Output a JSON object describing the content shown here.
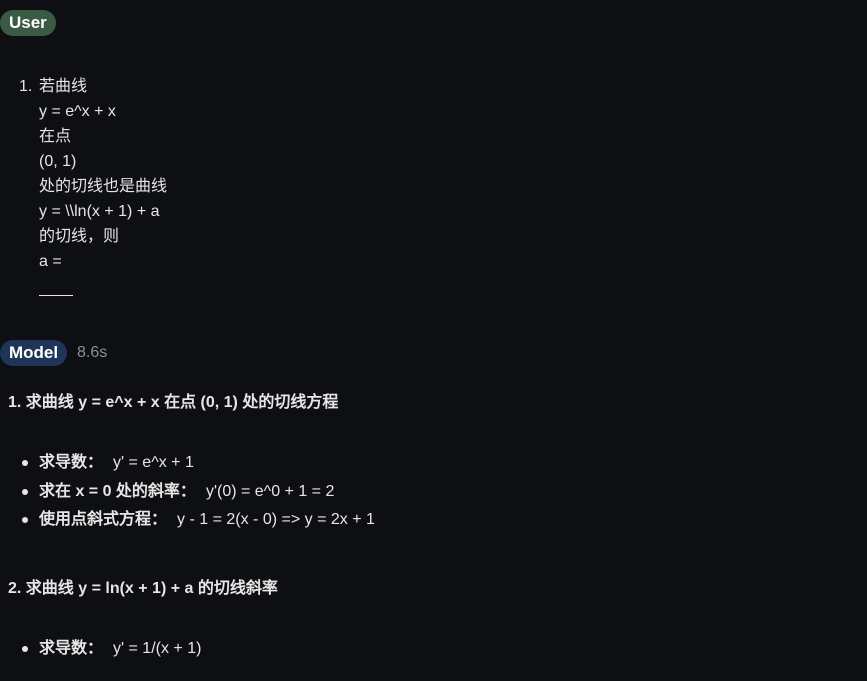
{
  "user": {
    "badge": "User",
    "number": "1.",
    "lines": [
      "若曲线",
      "y = e^x + x",
      "在点",
      "(0, 1)",
      "处的切线也是曲线",
      "y = \\\\ln(x + 1) + a",
      "的切线，则",
      "a ="
    ]
  },
  "model": {
    "badge": "Model",
    "time": "8.6s",
    "section1": {
      "title": "1. 求曲线 y = e^x + x 在点 (0, 1) 处的切线方程",
      "items": [
        {
          "label": "求导数：",
          "value": "y' = e^x + 1"
        },
        {
          "label": "求在 x = 0 处的斜率：",
          "value": "y'(0) = e^0 + 1 = 2"
        },
        {
          "label": "使用点斜式方程：",
          "value": "y - 1 = 2(x - 0) => y = 2x + 1"
        }
      ]
    },
    "section2": {
      "title": "2. 求曲线 y = ln(x + 1) + a 的切线斜率",
      "items": [
        {
          "label": "求导数：",
          "value": "y' = 1/(x + 1)"
        }
      ]
    }
  },
  "colors": {
    "background": "#0d0f12",
    "text": "#e6e6e6",
    "user_badge": "#3a5a44",
    "model_badge": "#1e3558",
    "muted": "#8a8f98"
  }
}
